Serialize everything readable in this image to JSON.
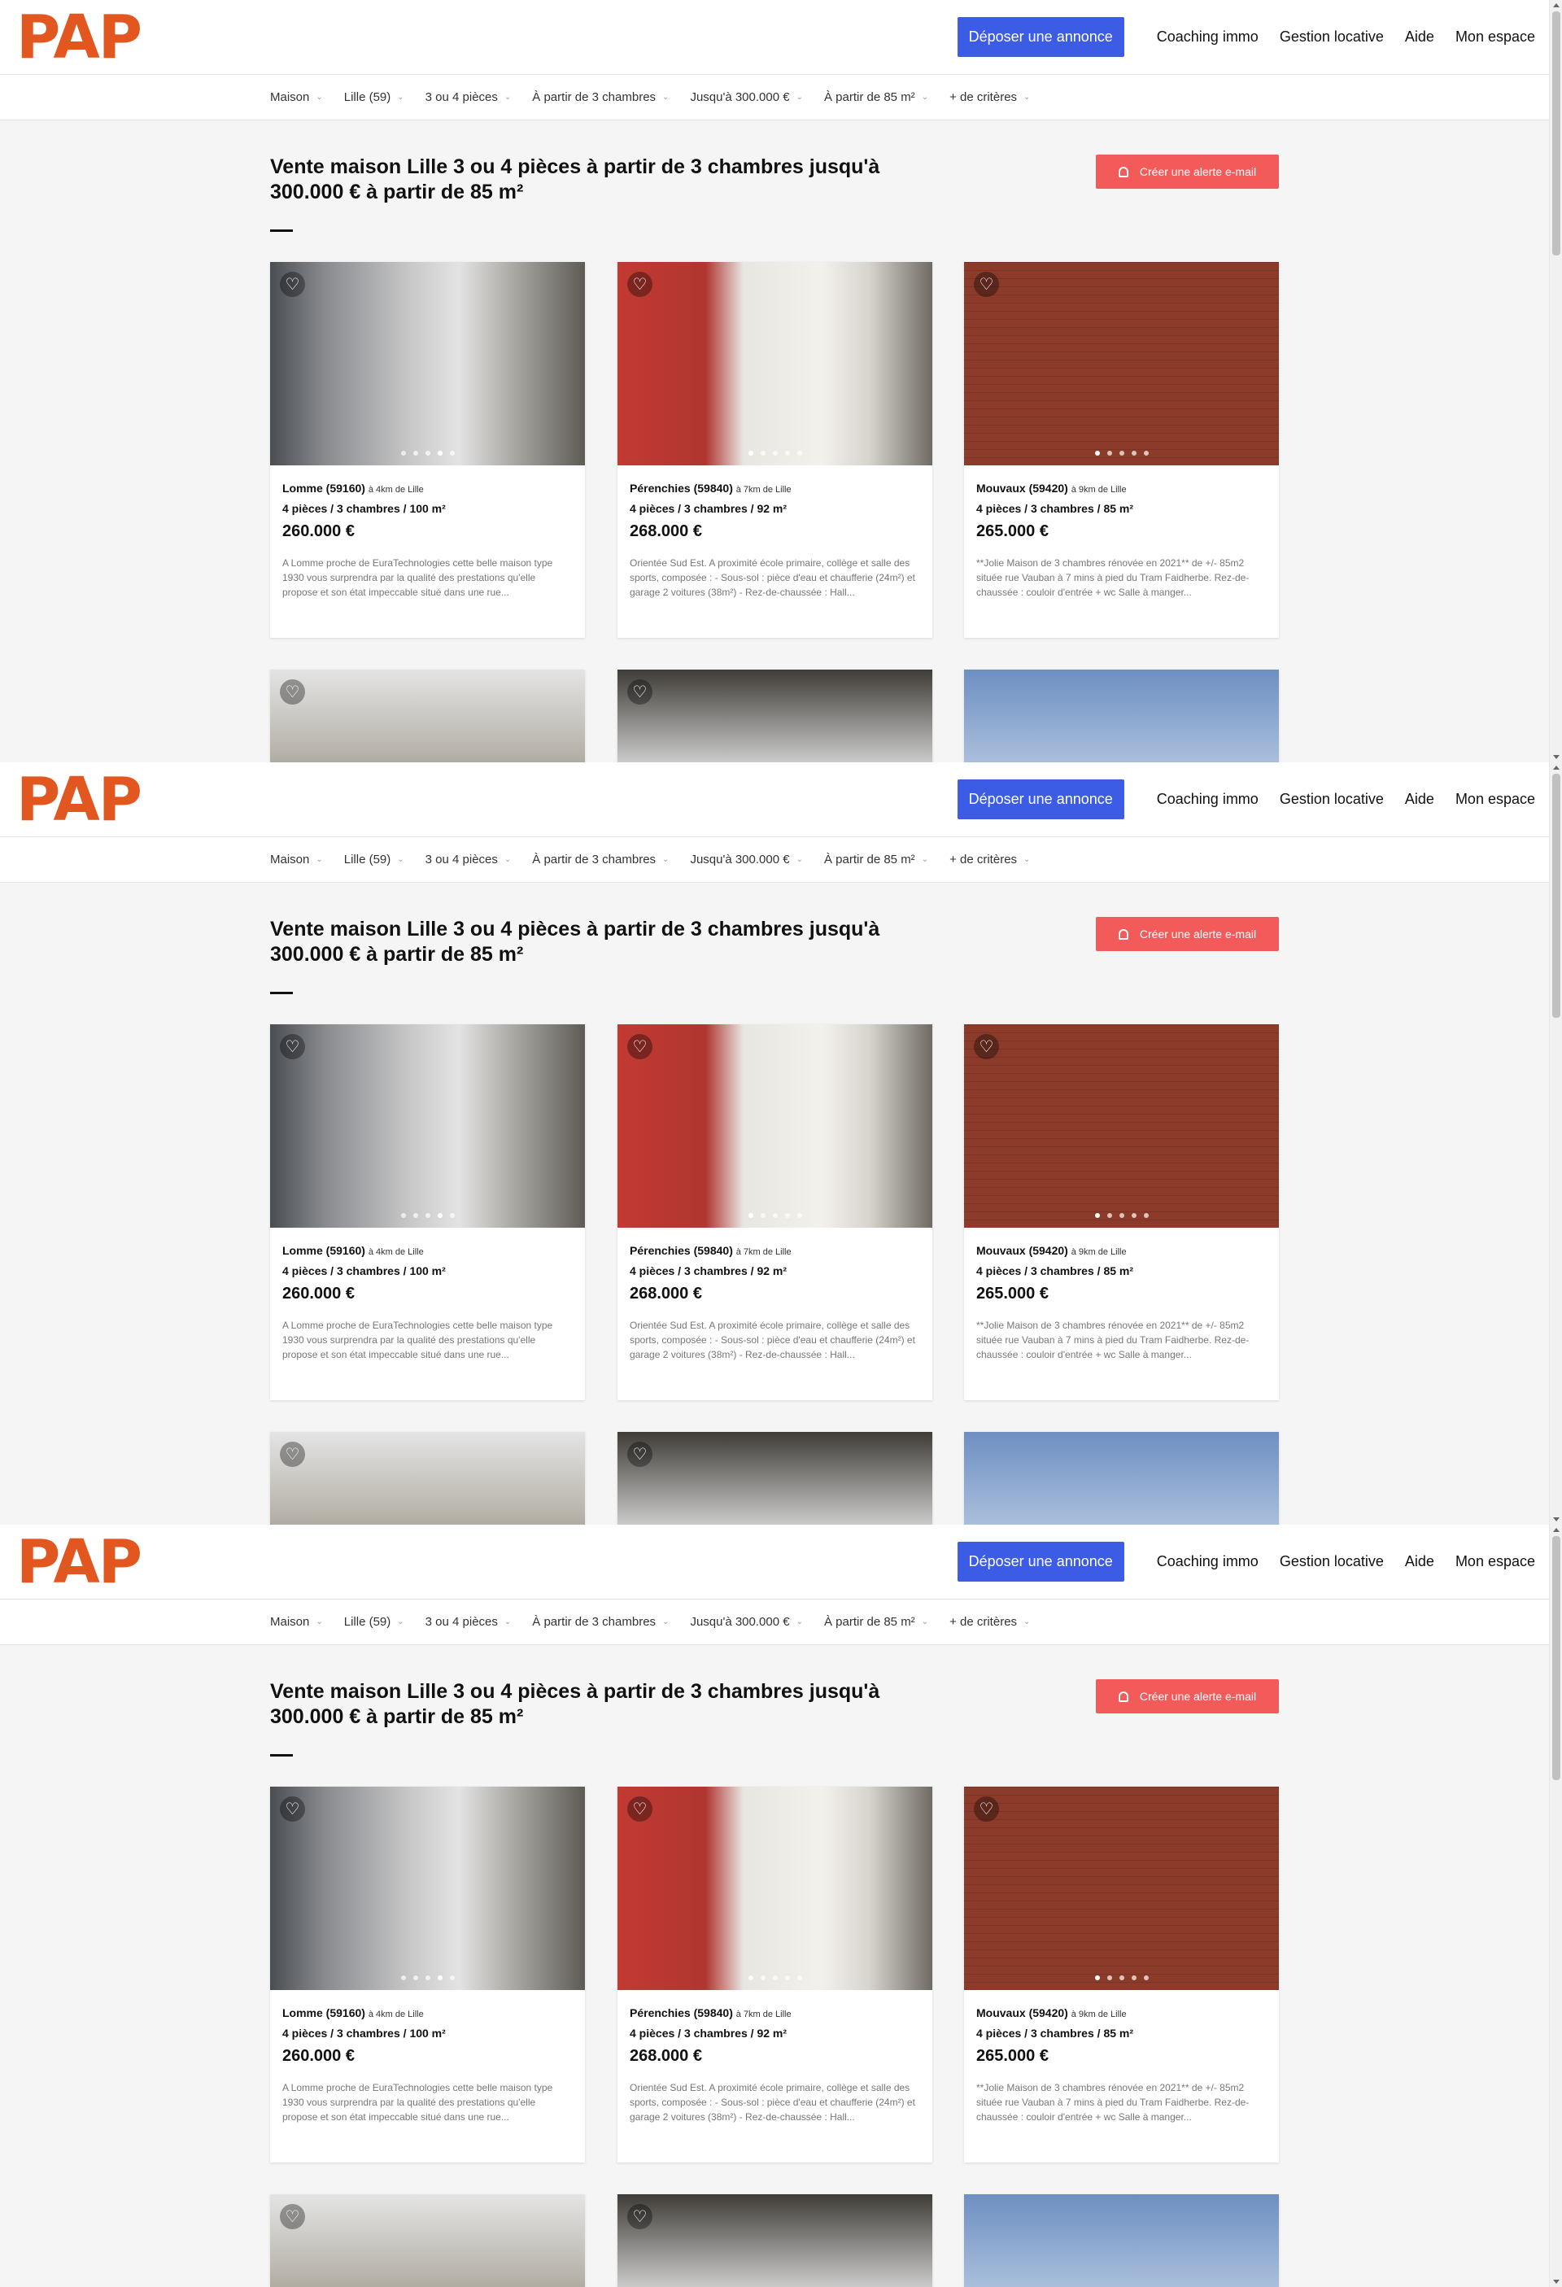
{
  "brand": {
    "logo": "PAP",
    "accent": "#e2571f",
    "cta_color": "#3d5ce6",
    "alert_color": "#f35b5b"
  },
  "nav": {
    "cta": "Déposer une annonce",
    "links": [
      "Coaching immo",
      "Gestion locative",
      "Aide",
      "Mon espace"
    ]
  },
  "filters": [
    "Maison",
    "Lille (59)",
    "3 ou 4 pièces",
    "À partir de 3 chambres",
    "Jusqu'à 300.000 €",
    "À partir de 85 m²",
    "+ de critères"
  ],
  "search": {
    "title_line1": "Vente maison Lille 3 ou 4 pièces à partir de 3 chambres jusqu'à",
    "title_line2": "300.000 € à partir de 85 m²",
    "alert_button": "Créer une alerte e-mail"
  },
  "listings": [
    {
      "city": "Lomme (59160)",
      "distance": "à 4km de Lille",
      "rooms": "4 pièces",
      "bedrooms": "3 chambres",
      "area": "100 m²",
      "price": "260.000 €",
      "desc": "A Lomme proche de EuraTechnologies cette belle maison type 1930 vous surprendra par la qualité des prestations qu'elle propose et son état impeccable situé dans une rue...",
      "active_dot": 3
    },
    {
      "city": "Pérenchies (59840)",
      "distance": "à 7km de Lille",
      "rooms": "4 pièces",
      "bedrooms": "3 chambres",
      "area": "92 m²",
      "price": "268.000 €",
      "desc": "Orientée Sud Est. A proximité école primaire, collège et salle des sports, composée : - Sous-sol : pièce d'eau et chaufferie (24m²) et garage 2 voitures (38m²) - Rez-de-chaussée : Hall...",
      "active_dot": 0
    },
    {
      "city": "Mouvaux (59420)",
      "distance": "à 9km de Lille",
      "rooms": "4 pièces",
      "bedrooms": "3 chambres",
      "area": "85 m²",
      "price": "265.000 €",
      "desc": "**Jolie Maison de 3 chambres rénovée en 2021** de +/- 85m2 située rue Vauban à 7 mins à pied du Tram Faidherbe. Rez-de-chaussée : couloir d'entrée + wc Salle à manger...",
      "active_dot": 0
    }
  ],
  "icons": {
    "favorite": "heart-icon",
    "alert": "bell-icon",
    "dropdown": "chevron-down-icon"
  }
}
